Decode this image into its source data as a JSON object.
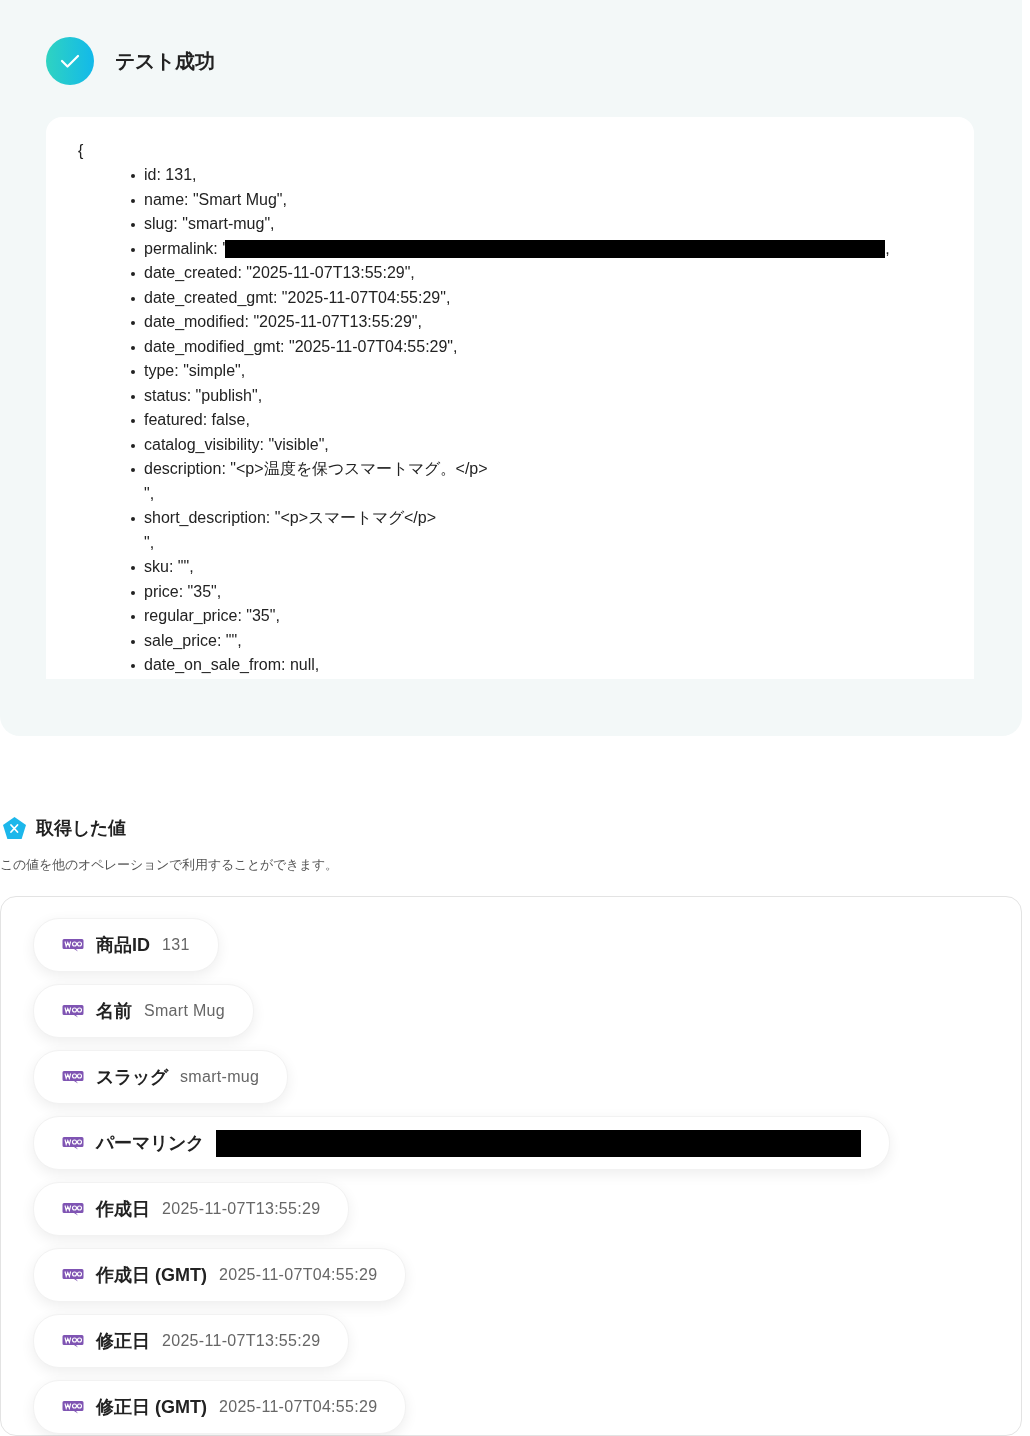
{
  "result": {
    "title": "テスト成功",
    "success": true,
    "open_brace": "{",
    "fields": [
      {
        "kind": "text",
        "text": "id: 131,"
      },
      {
        "kind": "text",
        "text": "name: \"Smart Mug\","
      },
      {
        "kind": "text",
        "text": "slug: \"smart-mug\","
      },
      {
        "kind": "redacted",
        "prefix": "permalink: '",
        "suffix": ","
      },
      {
        "kind": "text",
        "text": "date_created: \"2025-11-07T13:55:29\","
      },
      {
        "kind": "text",
        "text": "date_created_gmt: \"2025-11-07T04:55:29\","
      },
      {
        "kind": "text",
        "text": "date_modified: \"2025-11-07T13:55:29\","
      },
      {
        "kind": "text",
        "text": "date_modified_gmt: \"2025-11-07T04:55:29\","
      },
      {
        "kind": "text",
        "text": "type: \"simple\","
      },
      {
        "kind": "text",
        "text": "status: \"publish\","
      },
      {
        "kind": "text",
        "text": "featured: false,"
      },
      {
        "kind": "text",
        "text": "catalog_visibility: \"visible\","
      },
      {
        "kind": "text",
        "text": "description: \"<p>温度を保つスマートマグ。</p>\n\","
      },
      {
        "kind": "text",
        "text": "short_description: \"<p>スマートマグ</p>\n\","
      },
      {
        "kind": "text",
        "text": "sku: \"\","
      },
      {
        "kind": "text",
        "text": "price: \"35\","
      },
      {
        "kind": "text",
        "text": "regular_price: \"35\","
      },
      {
        "kind": "text",
        "text": "sale_price: \"\","
      },
      {
        "kind": "text",
        "text": "date_on_sale_from: null,"
      }
    ]
  },
  "values": {
    "title": "取得した値",
    "subtitle": "この値を他のオペレーションで利用することができます。",
    "items": [
      {
        "kind": "text",
        "label": "商品ID",
        "value": "131"
      },
      {
        "kind": "text",
        "label": "名前",
        "value": "Smart Mug"
      },
      {
        "kind": "text",
        "label": "スラッグ",
        "value": "smart-mug"
      },
      {
        "kind": "redacted",
        "label": "パーマリンク"
      },
      {
        "kind": "text",
        "label": "作成日",
        "value": "2025-11-07T13:55:29"
      },
      {
        "kind": "text",
        "label": "作成日 (GMT)",
        "value": "2025-11-07T04:55:29"
      },
      {
        "kind": "text",
        "label": "修正日",
        "value": "2025-11-07T13:55:29"
      },
      {
        "kind": "text",
        "label": "修正日 (GMT)",
        "value": "2025-11-07T04:55:29"
      }
    ]
  }
}
